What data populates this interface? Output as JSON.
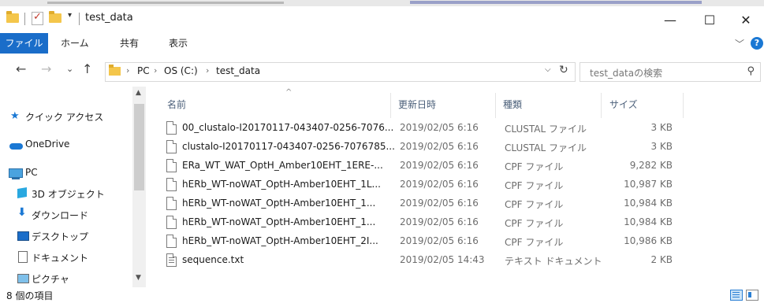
{
  "window": {
    "title": "test_data",
    "controls": {
      "minimize": "—",
      "maximize": "☐",
      "close": "✕"
    }
  },
  "ribbon": {
    "tabs": [
      "ファイル",
      "ホーム",
      "共有",
      "表示"
    ]
  },
  "address": {
    "crumbs": [
      "PC",
      "OS (C:)",
      "test_data"
    ],
    "search_placeholder": "test_dataの検索"
  },
  "nav_pane": {
    "items": [
      {
        "label": "クイック アクセス",
        "icon": "star-icon"
      },
      {
        "label": "OneDrive",
        "icon": "cloud-icon"
      },
      {
        "label": "PC",
        "icon": "computer-icon"
      },
      {
        "label": "3D オブジェクト",
        "icon": "cube-icon"
      },
      {
        "label": "ダウンロード",
        "icon": "download-icon"
      },
      {
        "label": "デスクトップ",
        "icon": "desktop-icon"
      },
      {
        "label": "ドキュメント",
        "icon": "document-icon"
      },
      {
        "label": "ピクチャ",
        "icon": "picture-icon"
      }
    ]
  },
  "file_list": {
    "columns": [
      "名前",
      "更新日時",
      "種類",
      "サイズ"
    ],
    "rows": [
      {
        "name": "00_clustalo-I20170117-043407-0256-7076...",
        "date": "2019/02/05 6:16",
        "type": "CLUSTAL ファイル",
        "size": "3 KB"
      },
      {
        "name": "clustalo-I20170117-043407-0256-7076785...",
        "date": "2019/02/05 6:16",
        "type": "CLUSTAL ファイル",
        "size": "3 KB"
      },
      {
        "name": "ERa_WT_WAT_OptH_Amber10EHT_1ERE-...",
        "date": "2019/02/05 6:16",
        "type": "CPF ファイル",
        "size": "9,282 KB"
      },
      {
        "name": "hERb_WT-noWAT_OptH-Amber10EHT_1L...",
        "date": "2019/02/05 6:16",
        "type": "CPF ファイル",
        "size": "10,987 KB"
      },
      {
        "name": "hERb_WT-noWAT_OptH-Amber10EHT_1...",
        "date": "2019/02/05 6:16",
        "type": "CPF ファイル",
        "size": "10,984 KB"
      },
      {
        "name": "hERb_WT-noWAT_OptH-Amber10EHT_1...",
        "date": "2019/02/05 6:16",
        "type": "CPF ファイル",
        "size": "10,984 KB"
      },
      {
        "name": "hERb_WT-noWAT_OptH-Amber10EHT_2I...",
        "date": "2019/02/05 6:16",
        "type": "CPF ファイル",
        "size": "10,986 KB"
      },
      {
        "name": "sequence.txt",
        "date": "2019/02/05 14:43",
        "type": "テキスト ドキュメント",
        "size": "2 KB"
      }
    ]
  },
  "status": {
    "item_count": "8 個の項目"
  },
  "colors": {
    "accent": "#1a6dc9",
    "folder": "#f4c64b",
    "column_header": "#4c607a"
  }
}
